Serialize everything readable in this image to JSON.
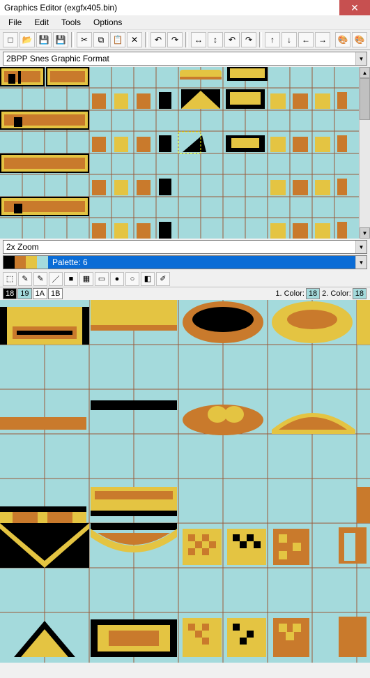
{
  "window": {
    "title": "Graphics Editor (exgfx405.bin)"
  },
  "menu": {
    "file": "File",
    "edit": "Edit",
    "tools": "Tools",
    "options": "Options"
  },
  "toolbar": {
    "new": "□",
    "open": "📂",
    "save": "💾",
    "save_as": "💾",
    "cut": "✂",
    "copy": "⧉",
    "paste": "📋",
    "delete": "✕",
    "undo": "↶",
    "redo": "↷",
    "flip_h": "↔",
    "flip_v": "↕",
    "rot_l": "↶",
    "rot_r": "↷",
    "arr_u": "↑",
    "arr_d": "↓",
    "arr_l": "←",
    "arr_r": "→",
    "palette_a": "🎨",
    "palette_b": "🎨"
  },
  "format_dropdown": {
    "value": "2BPP Snes Graphic Format"
  },
  "zoom_dropdown": {
    "value": "2x Zoom"
  },
  "palette": {
    "label": "Palette: 6",
    "swatches": [
      "#000000",
      "#c97a2c",
      "#e4c442",
      "#a4dadc"
    ]
  },
  "draw_tools": {
    "select": "⬚",
    "pencil1": "✎",
    "pencil2": "✎",
    "line": "／",
    "rect_fill": "■",
    "gradient": "▦",
    "rect": "▭",
    "circle_fill": "●",
    "circle": "○",
    "eraser": "◧",
    "picker": "✐"
  },
  "color_indices": {
    "i18": "18",
    "i19": "19",
    "i1a": "1A",
    "i1b": "1B"
  },
  "color_info": {
    "primary_label": "1. Color:",
    "primary_value": "18",
    "secondary_label": "2. Color:",
    "secondary_value": "18"
  },
  "chart_data": null
}
